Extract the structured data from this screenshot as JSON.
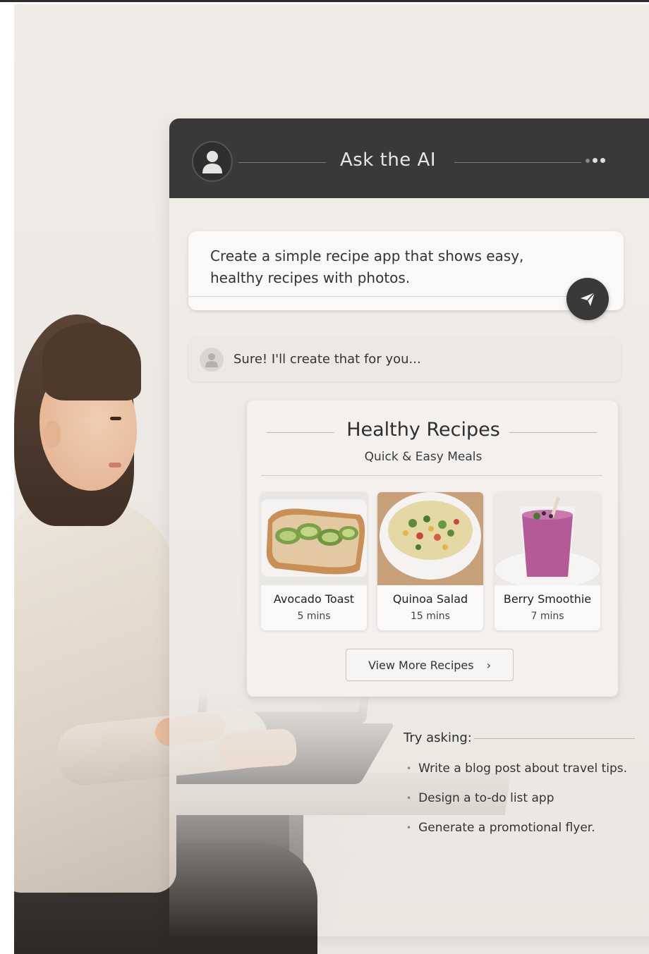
{
  "header": {
    "title": "Ask the AI"
  },
  "prompt": {
    "text_line1": "Create a simple recipe app that shows easy,",
    "text_line2": "healthy recipes with photos."
  },
  "reply": {
    "text": "Sure! I'll create that for you..."
  },
  "recipe_card": {
    "title": "Healthy Recipes",
    "subtitle": "Quick & Easy Meals",
    "recipes": [
      {
        "name": "Avocado Toast",
        "time": "5 mins"
      },
      {
        "name": "Quinoa Salad",
        "time": "15 mins"
      },
      {
        "name": "Berry Smoothie",
        "time": "7 mins"
      }
    ],
    "more_button": "View More Recipes",
    "more_chevron": "›"
  },
  "suggestions": {
    "heading": "Try asking:",
    "items": [
      "Write a blog post about travel tips.",
      "Design a to-do list app",
      "Generate a promotional flyer."
    ]
  },
  "colors": {
    "header_bg": "#3a3939",
    "panel_bg": "#f1eeea",
    "accent_dark": "#3a3939"
  }
}
